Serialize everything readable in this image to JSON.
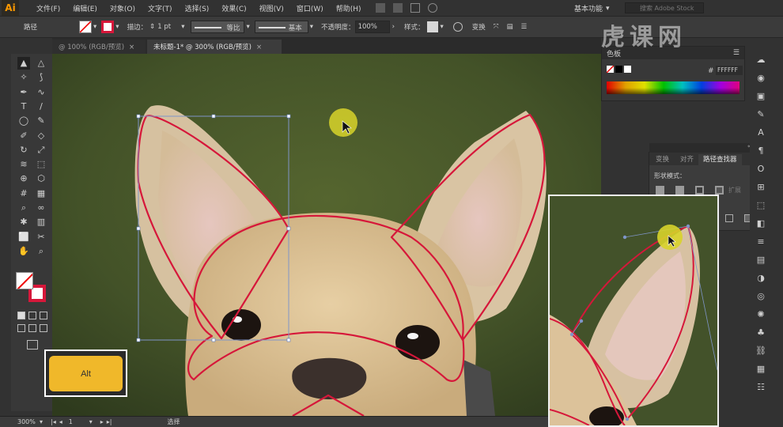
{
  "app": {
    "logo": "Ai",
    "workspace": "基本功能",
    "search_placeholder": "搜索 Adobe Stock"
  },
  "menu": [
    "文件(F)",
    "编辑(E)",
    "对象(O)",
    "文字(T)",
    "选择(S)",
    "效果(C)",
    "视图(V)",
    "窗口(W)",
    "帮助(H)"
  ],
  "control_bar": {
    "selection_label": "路径",
    "stroke_label": "描边：",
    "stroke_weight": "1 pt",
    "profile_label": "等比",
    "brush_label": "基本",
    "opacity_label": "不透明度：",
    "opacity_value": "100%",
    "style_label": "样式：",
    "transform_label": "变换"
  },
  "tabs": [
    {
      "label": "@ 100% (RGB/预览)",
      "active": false
    },
    {
      "label": "未标题-1* @ 300% (RGB/预览)",
      "active": true
    }
  ],
  "color_panel": {
    "title": "色板",
    "hex_prefix": "#",
    "hex_value": "FFFFFF"
  },
  "pathfinder": {
    "tabs": [
      "变换",
      "对齐",
      "路径查找器"
    ],
    "shape_modes_label": "形状模式：",
    "expand_label": "扩展"
  },
  "status": {
    "zoom": "300%",
    "page": "1",
    "tool": "选择"
  },
  "overlay": {
    "key_label": "Alt"
  },
  "watermark": "虎课网",
  "colors": {
    "path": "#d6173a",
    "cursor_highlight": "#d8d32a",
    "key": "#f0b82a",
    "accent": "#ff9a00"
  },
  "icons": [
    "selection-icon",
    "direct-selection-icon",
    "magic-wand-icon",
    "lasso-icon",
    "pen-icon",
    "curvature-icon",
    "type-icon",
    "line-icon",
    "ellipse-icon",
    "paintbrush-icon",
    "pencil-icon",
    "eraser-icon",
    "rotate-icon",
    "scale-icon",
    "width-icon",
    "free-transform-icon",
    "shape-builder-icon",
    "perspective-icon",
    "mesh-icon",
    "gradient-icon",
    "eyedropper-icon",
    "blend-icon",
    "symbol-sprayer-icon",
    "graph-icon",
    "artboard-icon",
    "slice-icon",
    "hand-icon",
    "zoom-icon"
  ]
}
